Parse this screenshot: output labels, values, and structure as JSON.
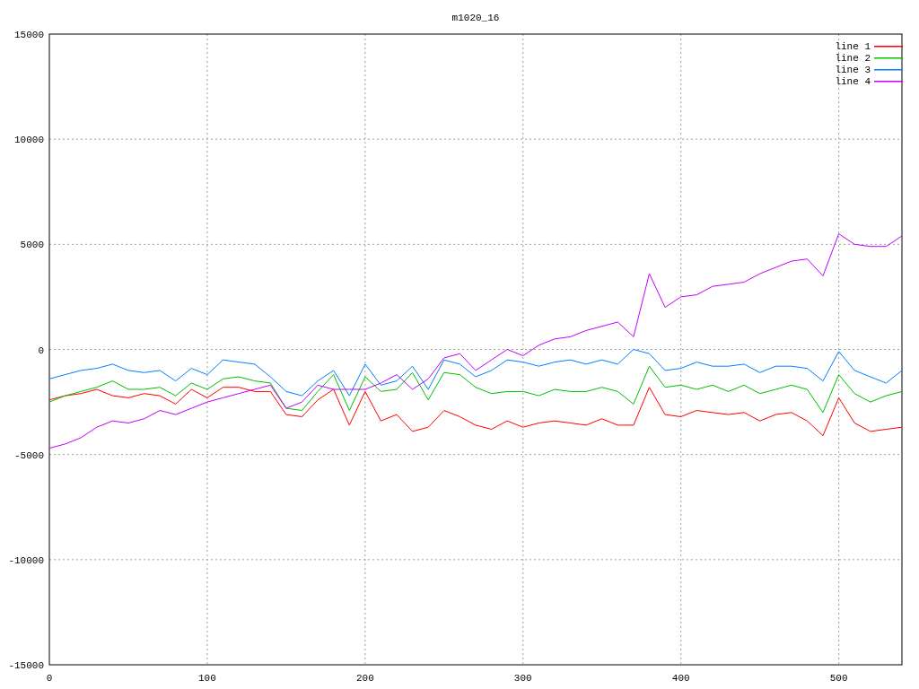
{
  "chart": {
    "chart_data": {
      "type": "line",
      "title": "m1020_16",
      "x": [
        0,
        10,
        20,
        30,
        40,
        50,
        60,
        70,
        80,
        90,
        100,
        110,
        120,
        130,
        140,
        150,
        160,
        170,
        180,
        190,
        200,
        210,
        220,
        230,
        240,
        250,
        260,
        270,
        280,
        290,
        300,
        310,
        320,
        330,
        340,
        350,
        360,
        370,
        380,
        390,
        400,
        410,
        420,
        430,
        440,
        450,
        460,
        470,
        480,
        490,
        500,
        510,
        520,
        530,
        540
      ],
      "series": [
        {
          "name": "line 1",
          "color": "#ff0000",
          "values": [
            -2400,
            -2200,
            -2100,
            -1900,
            -2200,
            -2300,
            -2100,
            -2200,
            -2600,
            -1900,
            -2300,
            -1800,
            -1800,
            -2000,
            -2000,
            -3100,
            -3200,
            -2400,
            -1900,
            -3600,
            -2000,
            -3400,
            -3100,
            -3900,
            -3700,
            -2900,
            -3200,
            -3600,
            -3800,
            -3400,
            -3700,
            -3500,
            -3400,
            -3500,
            -3600,
            -3300,
            -3600,
            -3600,
            -1800,
            -3100,
            -3200,
            -2900,
            -3000,
            -3100,
            -3000,
            -3400,
            -3100,
            -3000,
            -3400,
            -4100,
            -2300,
            -3500,
            -3900,
            -3800,
            -3700
          ]
        },
        {
          "name": "line 2",
          "color": "#00c000",
          "values": [
            -2500,
            -2200,
            -2000,
            -1800,
            -1500,
            -1900,
            -1900,
            -1800,
            -2200,
            -1600,
            -1900,
            -1400,
            -1300,
            -1500,
            -1600,
            -2800,
            -2900,
            -2000,
            -1200,
            -2900,
            -1300,
            -2000,
            -1900,
            -1100,
            -2400,
            -1100,
            -1200,
            -1800,
            -2100,
            -2000,
            -2000,
            -2200,
            -1900,
            -2000,
            -2000,
            -1800,
            -2000,
            -2600,
            -800,
            -1800,
            -1700,
            -1900,
            -1700,
            -2000,
            -1700,
            -2100,
            -1900,
            -1700,
            -1900,
            -3000,
            -1200,
            -2100,
            -2500,
            -2200,
            -2000
          ]
        },
        {
          "name": "line 3",
          "color": "#0080ff",
          "values": [
            -1400,
            -1200,
            -1000,
            -900,
            -700,
            -1000,
            -1100,
            -1000,
            -1500,
            -900,
            -1200,
            -500,
            -600,
            -700,
            -1300,
            -2000,
            -2200,
            -1500,
            -1000,
            -2200,
            -700,
            -1700,
            -1500,
            -800,
            -1900,
            -500,
            -700,
            -1300,
            -1000,
            -500,
            -600,
            -800,
            -600,
            -500,
            -700,
            -500,
            -700,
            0,
            -200,
            -1000,
            -900,
            -600,
            -800,
            -800,
            -700,
            -1100,
            -800,
            -800,
            -900,
            -1500,
            -100,
            -1000,
            -1300,
            -1600,
            -1000
          ]
        },
        {
          "name": "line 4",
          "color": "#c000ff",
          "values": [
            -4700,
            -4500,
            -4200,
            -3700,
            -3400,
            -3500,
            -3300,
            -2900,
            -3100,
            -2800,
            -2500,
            -2300,
            -2100,
            -1900,
            -1700,
            -2800,
            -2500,
            -1700,
            -1900,
            -1900,
            -1900,
            -1600,
            -1200,
            -1900,
            -1400,
            -400,
            -200,
            -1000,
            -500,
            0,
            -300,
            200,
            500,
            600,
            900,
            1100,
            1300,
            600,
            3600,
            2000,
            2500,
            2600,
            3000,
            3100,
            3200,
            3600,
            3900,
            4200,
            4300,
            3500,
            5500,
            5000,
            4900,
            4900,
            5400
          ]
        }
      ],
      "legend": true,
      "grid": true,
      "xlim": [
        0,
        540
      ],
      "ylim": [
        -15000,
        15000
      ],
      "xticks": [
        0,
        100,
        200,
        300,
        400,
        500
      ],
      "yticks": [
        -15000,
        -10000,
        -5000,
        0,
        5000,
        10000,
        15000
      ]
    }
  }
}
